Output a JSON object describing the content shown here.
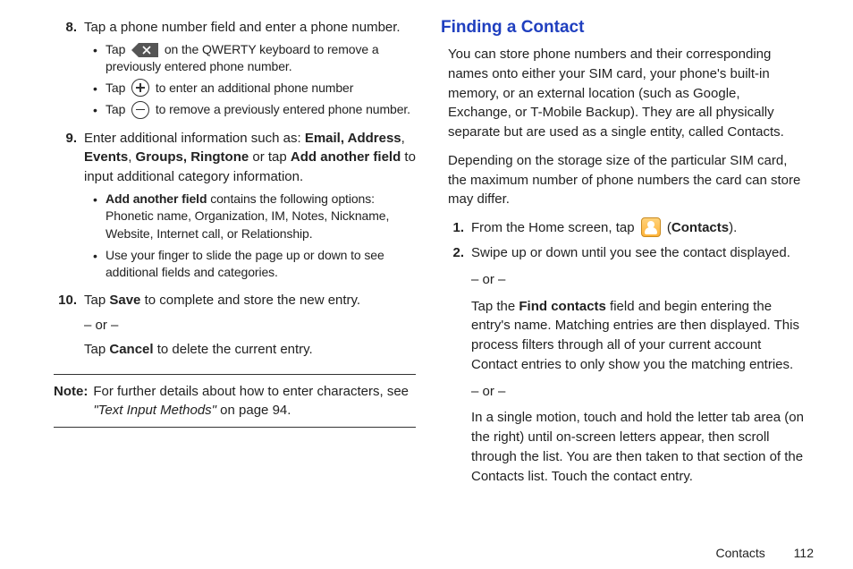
{
  "left": {
    "item8": {
      "num": "8.",
      "text_a": "Tap a phone number field and enter a phone number.",
      "b1_a": "Tap ",
      "b1_b": " on the QWERTY keyboard to remove a previously entered phone number.",
      "b2_a": "Tap ",
      "b2_b": " to enter an additional phone number",
      "b3_a": "Tap ",
      "b3_b": " to remove a previously entered phone number."
    },
    "item9": {
      "num": "9.",
      "text_a": "Enter additional information such as: ",
      "bold1": "Email, Address",
      "sep1": ", ",
      "bold2": "Events",
      "sep2": ", ",
      "bold3": "Groups, Ringtone",
      "mid": " or tap ",
      "bold4": "Add another field",
      "text_b": " to input additional category information.",
      "b1_bold": "Add another field",
      "b1_rest": " contains the following options: Phonetic name, Organization, IM, Notes, Nickname, Website, Internet call, or Relationship.",
      "b2": "Use your finger to slide the page up or down to see additional fields and categories."
    },
    "item10": {
      "num": "10.",
      "text_a": "Tap ",
      "bold1": "Save",
      "text_b": " to complete and store the new entry.",
      "or": "– or –",
      "text_c": "Tap ",
      "bold2": "Cancel",
      "text_d": " to delete the current entry."
    },
    "note": {
      "label": "Note:",
      "body_a": "For further details about how to enter characters, see ",
      "em": "\"Text Input Methods\"",
      "body_b": " on page 94."
    }
  },
  "right": {
    "heading": "Finding a Contact",
    "p1": "You can store phone numbers and their corresponding names onto either your SIM card, your phone's built-in memory, or an external location (such as Google, Exchange, or T-Mobile Backup). They are all physically separate but are used as a single entity, called Contacts.",
    "p2": "Depending on the storage size of the particular SIM card, the maximum number of phone numbers the card can store may differ.",
    "s1": {
      "num": "1.",
      "a": "From the Home screen, tap ",
      "paren_open": " (",
      "bold": "Contacts",
      "paren_close": ")."
    },
    "s2": {
      "num": "2.",
      "a": "Swipe up or down until you see the contact displayed.",
      "or1": "– or –",
      "b_a": "Tap the ",
      "b_bold": "Find contacts",
      "b_b": " field and begin entering the entry's name. Matching entries are then displayed. This process filters through all of your current account Contact entries to only show you the matching entries.",
      "or2": "– or –",
      "c": "In a single motion, touch and hold the letter tab area (on the right) until on-screen letters appear, then scroll through the list. You are then taken to that section of the Contacts list. Touch the contact entry."
    }
  },
  "footer": {
    "section": "Contacts",
    "page": "112"
  }
}
